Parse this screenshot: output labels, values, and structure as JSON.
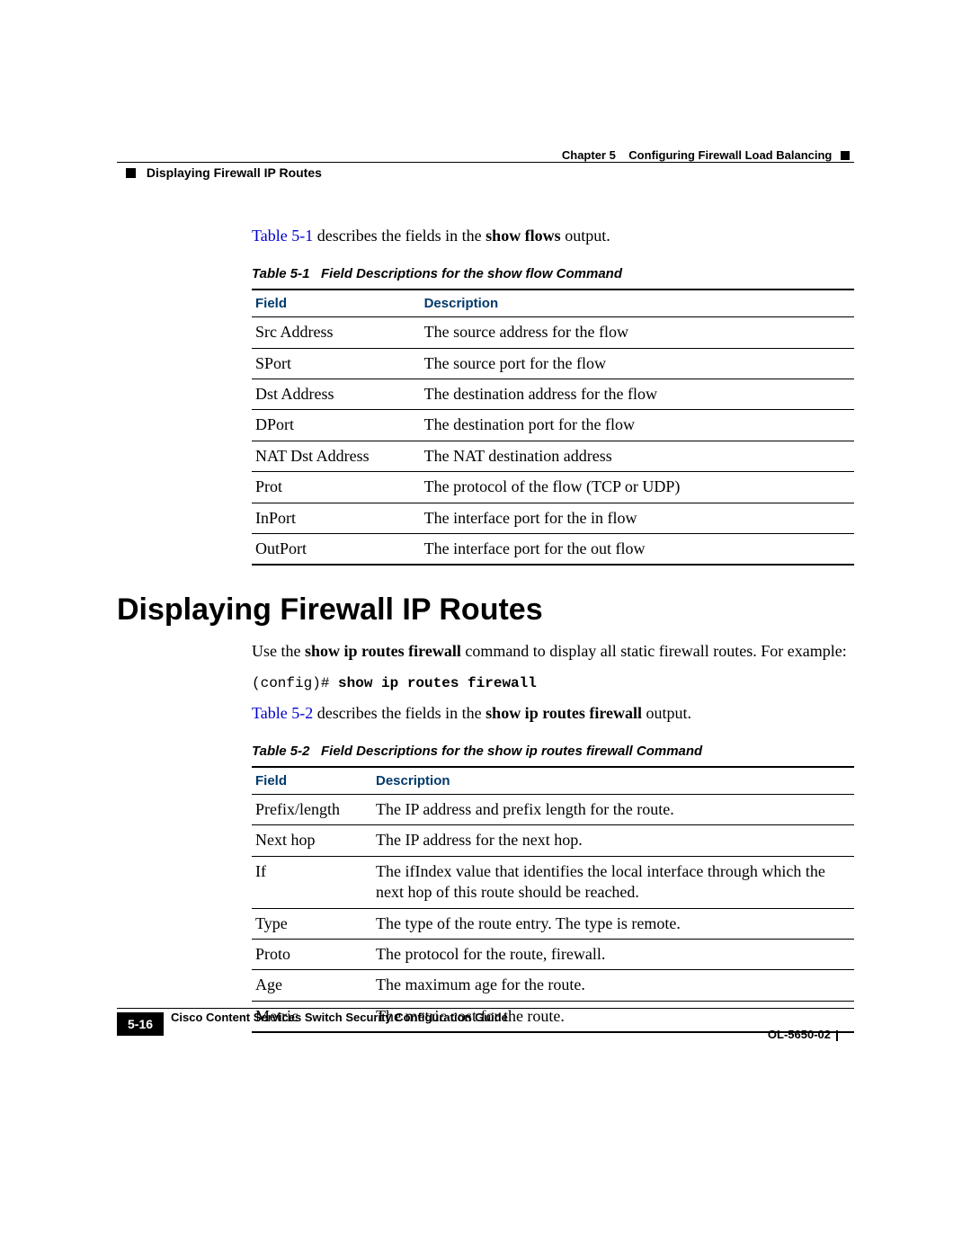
{
  "header": {
    "chapter_ref": "Chapter 5",
    "chapter_title": "Configuring Firewall Load Balancing",
    "section_running": "Displaying Firewall IP Routes"
  },
  "intro1_link": "Table 5-1",
  "intro1_rest": " describes the fields in the ",
  "intro1_bold": "show flows",
  "intro1_end": " output.",
  "table1": {
    "caption_num": "Table 5-1",
    "caption_text": "Field Descriptions for the show flow Command",
    "col1": "Field",
    "col2": "Description",
    "rows": [
      {
        "f": "Src Address",
        "d": "The source address for the flow"
      },
      {
        "f": "SPort",
        "d": "The source port for the flow"
      },
      {
        "f": "Dst Address",
        "d": "The destination address for the flow"
      },
      {
        "f": "DPort",
        "d": "The destination port for the flow"
      },
      {
        "f": "NAT Dst Address",
        "d": "The NAT destination address"
      },
      {
        "f": "Prot",
        "d": "The protocol of the flow (TCP or UDP)"
      },
      {
        "f": "InPort",
        "d": "The interface port for the in flow"
      },
      {
        "f": "OutPort",
        "d": "The interface port for the out flow"
      }
    ]
  },
  "section_title": "Displaying Firewall IP Routes",
  "para2_a": "Use the ",
  "para2_b": "show ip routes firewall",
  "para2_c": " command to display all static firewall routes. For example:",
  "code_prompt": "(config)# ",
  "code_cmd": "show ip routes firewall",
  "intro2_link": "Table 5-2",
  "intro2_rest": " describes the fields in the ",
  "intro2_bold": "show ip routes firewall",
  "intro2_end": " output.",
  "table2": {
    "caption_num": "Table 5-2",
    "caption_text": "Field Descriptions for the show ip routes firewall Command",
    "col1": "Field",
    "col2": "Description",
    "rows": [
      {
        "f": "Prefix/length",
        "d": "The IP address and prefix length for the route."
      },
      {
        "f": "Next hop",
        "d": "The IP address for the next hop."
      },
      {
        "f": "If",
        "d": "The ifIndex value that identifies the local interface through which the next hop of this route should be reached."
      },
      {
        "f": "Type",
        "d": "The type of the route entry. The type is remote."
      },
      {
        "f": "Proto",
        "d": "The protocol for the route, firewall."
      },
      {
        "f": "Age",
        "d": "The maximum age for the route."
      },
      {
        "f": "Metric",
        "d": "The metric cost for the route."
      }
    ]
  },
  "footer": {
    "book_title": "Cisco Content Services Switch  Security Configuration Guide",
    "page": "5-16",
    "doc_id": "OL-5650-02"
  }
}
